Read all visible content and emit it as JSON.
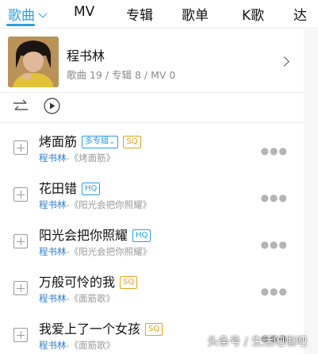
{
  "tabs": [
    {
      "label": "歌曲",
      "active": true
    },
    {
      "label": "MV",
      "active": false
    },
    {
      "label": "专辑",
      "active": false
    },
    {
      "label": "歌单",
      "active": false
    },
    {
      "label": "K歌",
      "active": false
    },
    {
      "label": "达",
      "active": false
    }
  ],
  "artist": {
    "name": "程书林",
    "stats": "歌曲 19 / 专辑 8 / MV 0"
  },
  "songs": [
    {
      "title": "烤面筋",
      "badges": [
        "多专辑",
        "SQ"
      ],
      "artist": "程书林",
      "album": "-《烤面筋》"
    },
    {
      "title": "花田错",
      "badges": [
        "HQ"
      ],
      "artist": "程书林",
      "album": "-《阳光会把你照耀》"
    },
    {
      "title": "阳光会把你照耀",
      "badges": [
        "HQ"
      ],
      "artist": "程书林",
      "album": "-《阳光会把你照耀》"
    },
    {
      "title": "万般可怜的我",
      "badges": [
        "SQ"
      ],
      "artist": "程书林",
      "album": "-《面筋歌》"
    },
    {
      "title": "我爱上了一个女孩",
      "badges": [
        "SQ"
      ],
      "artist": "程书林",
      "album": "-《面筋歌》"
    }
  ],
  "more_icon": "more-dots-icon",
  "watermark": "头条号 / 生活吧啦吧",
  "colors": {
    "accent": "#2a9ee6",
    "sq": "#e3a21a",
    "artist_link": "#2a7fd4"
  }
}
